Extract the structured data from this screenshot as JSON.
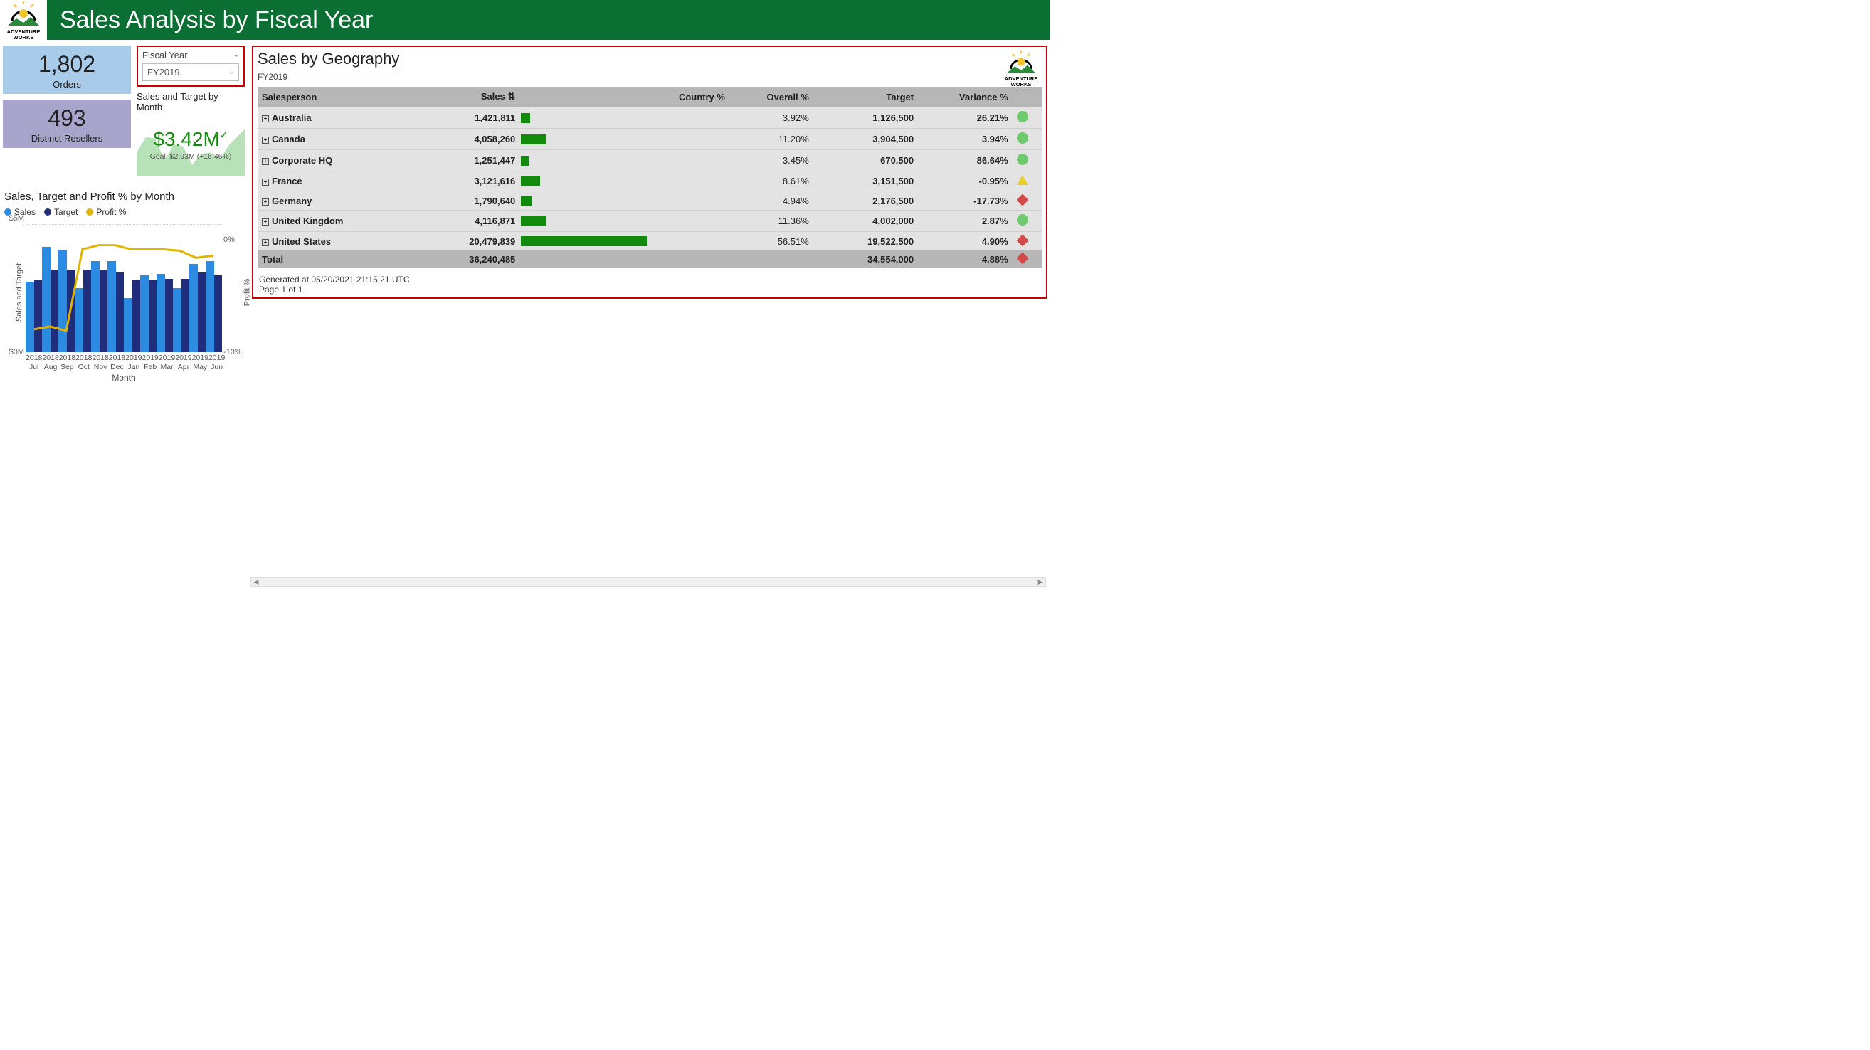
{
  "brand": {
    "logo_line1": "ADVENTURE",
    "logo_line2": "WORKS"
  },
  "header": {
    "title": "Sales Analysis by Fiscal Year"
  },
  "kpi": {
    "orders_value": "1,802",
    "orders_label": "Orders",
    "resellers_value": "493",
    "resellers_label": "Distinct Resellers"
  },
  "slicer": {
    "label": "Fiscal Year",
    "value": "FY2019"
  },
  "sparkline": {
    "title": "Sales and Target by Month",
    "value": "$3.42M",
    "goal": "Goal: $2.93M (+16.46%)"
  },
  "chart": {
    "title": "Sales, Target and Profit % by Month",
    "legend_sales": "Sales",
    "legend_target": "Target",
    "legend_profit": "Profit %",
    "y_left_top": "$5M",
    "y_left_bot": "$0M",
    "y_right_top": "0%",
    "y_right_bot": "-10%",
    "y_left_label": "Sales and Target",
    "y_right_label": "Profit %",
    "x_axis_title": "Month"
  },
  "geo": {
    "title": "Sales by Geography",
    "fy": "FY2019",
    "col_salesperson": "Salesperson",
    "col_sales": "Sales",
    "col_country": "Country %",
    "col_overall": "Overall %",
    "col_target": "Target",
    "col_variance": "Variance %",
    "rows": [
      {
        "name": "Australia",
        "sales": "1,421,811",
        "overall": "3.92%",
        "target": "1,126,500",
        "variance": "26.21%",
        "ind": "g"
      },
      {
        "name": "Canada",
        "sales": "4,058,260",
        "overall": "11.20%",
        "target": "3,904,500",
        "variance": "3.94%",
        "ind": "g"
      },
      {
        "name": "Corporate HQ",
        "sales": "1,251,447",
        "overall": "3.45%",
        "target": "670,500",
        "variance": "86.64%",
        "ind": "g"
      },
      {
        "name": "France",
        "sales": "3,121,616",
        "overall": "8.61%",
        "target": "3,151,500",
        "variance": "-0.95%",
        "ind": "y"
      },
      {
        "name": "Germany",
        "sales": "1,790,640",
        "overall": "4.94%",
        "target": "2,176,500",
        "variance": "-17.73%",
        "ind": "r"
      },
      {
        "name": "United Kingdom",
        "sales": "4,116,871",
        "overall": "11.36%",
        "target": "4,002,000",
        "variance": "2.87%",
        "ind": "g"
      },
      {
        "name": "United States",
        "sales": "20,479,839",
        "overall": "56.51%",
        "target": "19,522,500",
        "variance": "4.90%",
        "ind": "r"
      }
    ],
    "total_label": "Total",
    "total_sales": "36,240,485",
    "total_target": "34,554,000",
    "total_variance": "4.88%",
    "foot_generated": "Generated at 05/20/2021 21:15:21 UTC",
    "foot_page": "Page 1 of 1"
  },
  "chart_data": [
    {
      "type": "bar",
      "title": "Sales, Target and Profit % by Month",
      "categories": [
        "2018 Jul",
        "2018 Aug",
        "2018 Sep",
        "2018 Oct",
        "2018 Nov",
        "2018 Dec",
        "2019 Jan",
        "2019 Feb",
        "2019 Mar",
        "2019 Apr",
        "2019 May",
        "2019 Jun"
      ],
      "series": [
        {
          "name": "Sales",
          "values": [
            2.75,
            4.1,
            4.0,
            2.5,
            3.55,
            3.55,
            2.1,
            3.0,
            3.05,
            2.5,
            3.45,
            3.55
          ],
          "unit": "$M"
        },
        {
          "name": "Target",
          "values": [
            2.8,
            3.2,
            3.2,
            3.2,
            3.2,
            3.1,
            2.8,
            2.8,
            2.85,
            2.85,
            3.1,
            3.0
          ],
          "unit": "$M"
        },
        {
          "name": "Profit %",
          "values": [
            -8.0,
            -7.5,
            -8.5,
            0.5,
            1.0,
            1.0,
            0.5,
            0.5,
            0.5,
            0.3,
            -0.5,
            -0.3
          ],
          "unit": "%"
        }
      ],
      "xlabel": "Month",
      "ylabel": "Sales and Target",
      "ylim": [
        0,
        5
      ],
      "y2label": "Profit %",
      "y2lim": [
        -10,
        0
      ]
    },
    {
      "type": "area",
      "title": "Sales and Target by Month",
      "value": 3420000,
      "goal": 2930000,
      "variance_pct": 16.46
    },
    {
      "type": "table",
      "title": "Sales by Geography",
      "columns": [
        "Salesperson",
        "Sales",
        "Country %",
        "Overall %",
        "Target",
        "Variance %"
      ],
      "rows": [
        [
          "Australia",
          1421811,
          null,
          3.92,
          1126500,
          26.21
        ],
        [
          "Canada",
          4058260,
          null,
          11.2,
          3904500,
          3.94
        ],
        [
          "Corporate HQ",
          1251447,
          null,
          3.45,
          670500,
          86.64
        ],
        [
          "France",
          3121616,
          null,
          8.61,
          3151500,
          -0.95
        ],
        [
          "Germany",
          1790640,
          null,
          4.94,
          2176500,
          -17.73
        ],
        [
          "United Kingdom",
          4116871,
          null,
          11.36,
          4002000,
          2.87
        ],
        [
          "United States",
          20479839,
          null,
          56.51,
          19522500,
          4.9
        ]
      ],
      "total": [
        "Total",
        36240485,
        null,
        null,
        34554000,
        4.88
      ]
    }
  ]
}
